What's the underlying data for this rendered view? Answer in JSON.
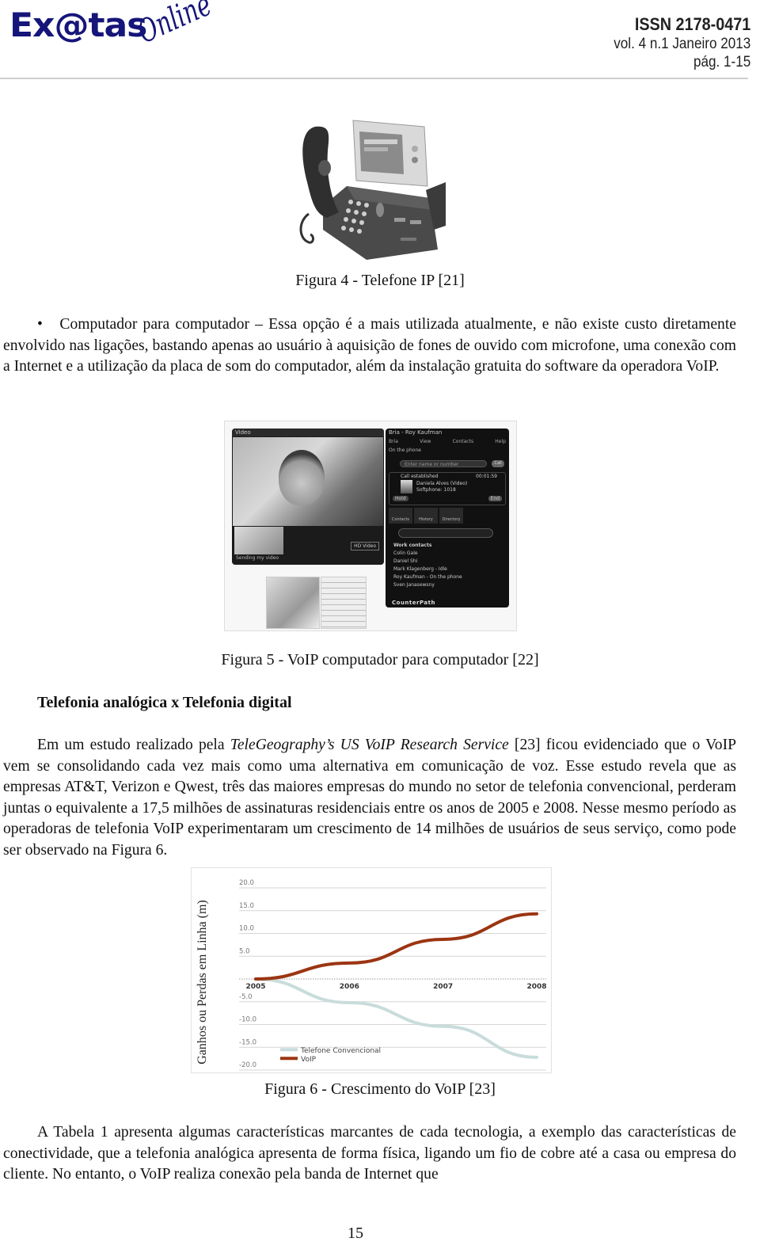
{
  "header": {
    "logo_main": "Ex@tas",
    "logo_script": "Online",
    "issn": "ISSN 2178-0471",
    "volume": "vol. 4 n.1 Janeiro  2013",
    "pages": "pág. 1-15",
    "brand_color": "#15157a"
  },
  "figure4": {
    "caption": "Figura 4 - Telefone IP [21]",
    "image_alt": "IP desk phone"
  },
  "bullet_paragraph": {
    "bullet": "•",
    "text": "Computador para computador – Essa opção é a mais utilizada atualmente, e não existe custo diretamente envolvido nas ligações, bastando apenas ao usuário à aquisição de fones de ouvido com microfone, uma conexão com a Internet e a utilização da placa de som do computador, além da instalação gratuita do software da operadora VoIP."
  },
  "figure5": {
    "caption": "Figura 5 - VoIP computador para computador [22]",
    "softphone": {
      "video_title": "Video",
      "pip_label": "Sending my video",
      "hd_button": "HD Video",
      "window_title": "Bria - Roy Kaufman",
      "menu": [
        "Bria",
        "View",
        "Contacts",
        "Help"
      ],
      "status": "On the phone",
      "search_placeholder": "Enter name or number",
      "call_button": "Call",
      "call_status": "Call established",
      "call_timer": "00:01:59",
      "caller_name": "Daniela Alves (Video)",
      "caller_device": "Softphone: 1018",
      "hold_button": "Hold",
      "end_button": "End",
      "tabs": [
        "Contacts",
        "History",
        "Directory"
      ],
      "contact_group": "Work contacts",
      "contacts": [
        "Colin Gale",
        "Daniel Shi",
        "Mark Klagenberg - Idle",
        "Roy Kaufman - On the phone",
        "Sven Janasewsny"
      ],
      "brand": "CounterPath"
    }
  },
  "section_heading": "Telefonia analógica x Telefonia digital",
  "paragraph_study": {
    "before_italic": "Em um estudo realizado pela ",
    "italic": "TeleGeography’s US VoIP Research Service",
    "after_italic": " [23] ficou evidenciado que o VoIP vem se consolidando cada vez mais como uma alternativa em comunicação de voz. Esse estudo revela que as empresas AT&T, Verizon e Qwest, três das maiores empresas do mundo no setor de telefonia convencional, perderam juntas o equivalente a 17,5 milhões de assinaturas residenciais entre os anos de 2005 e 2008. Nesse mesmo período as operadoras de telefonia VoIP experimentaram um crescimento de 14 milhões de usuários de seus serviço, como pode ser observado na Figura 6."
  },
  "chart_data": {
    "type": "line",
    "title": "",
    "xlabel": "",
    "ylabel": "Ganhos ou Perdas em Linha (m)",
    "x": [
      "2005",
      "2006",
      "2007",
      "2008"
    ],
    "ylim": [
      -20,
      20
    ],
    "yticks": [
      "20.0",
      "15.0",
      "10.0",
      "5.0",
      "-5.0",
      "-10.0",
      "-15.0",
      "-20.0"
    ],
    "ytick_values": [
      20,
      15,
      10,
      5,
      -5,
      -10,
      -15,
      -20
    ],
    "grid": true,
    "zero_line": "dotted",
    "legend_position": "bottom-left",
    "series": [
      {
        "name": "Telefone Convencional",
        "color": "#c9dcdc",
        "values": [
          0,
          -5.2,
          -10.4,
          -17.2
        ]
      },
      {
        "name": "VoIP",
        "color": "#9b3512",
        "values": [
          0,
          3.5,
          8.7,
          14.3
        ]
      }
    ]
  },
  "figure6": {
    "caption": "Figura 6 - Crescimento do VoIP [23]"
  },
  "paragraph_table": {
    "text": "A Tabela 1 apresenta algumas características marcantes de cada tecnologia, a exemplo das características de conectividade, que a telefonia analógica apresenta de forma física, ligando um fio de cobre até a casa ou empresa do cliente. No entanto, o VoIP realiza conexão pela banda de Internet que"
  },
  "page_number": "15"
}
